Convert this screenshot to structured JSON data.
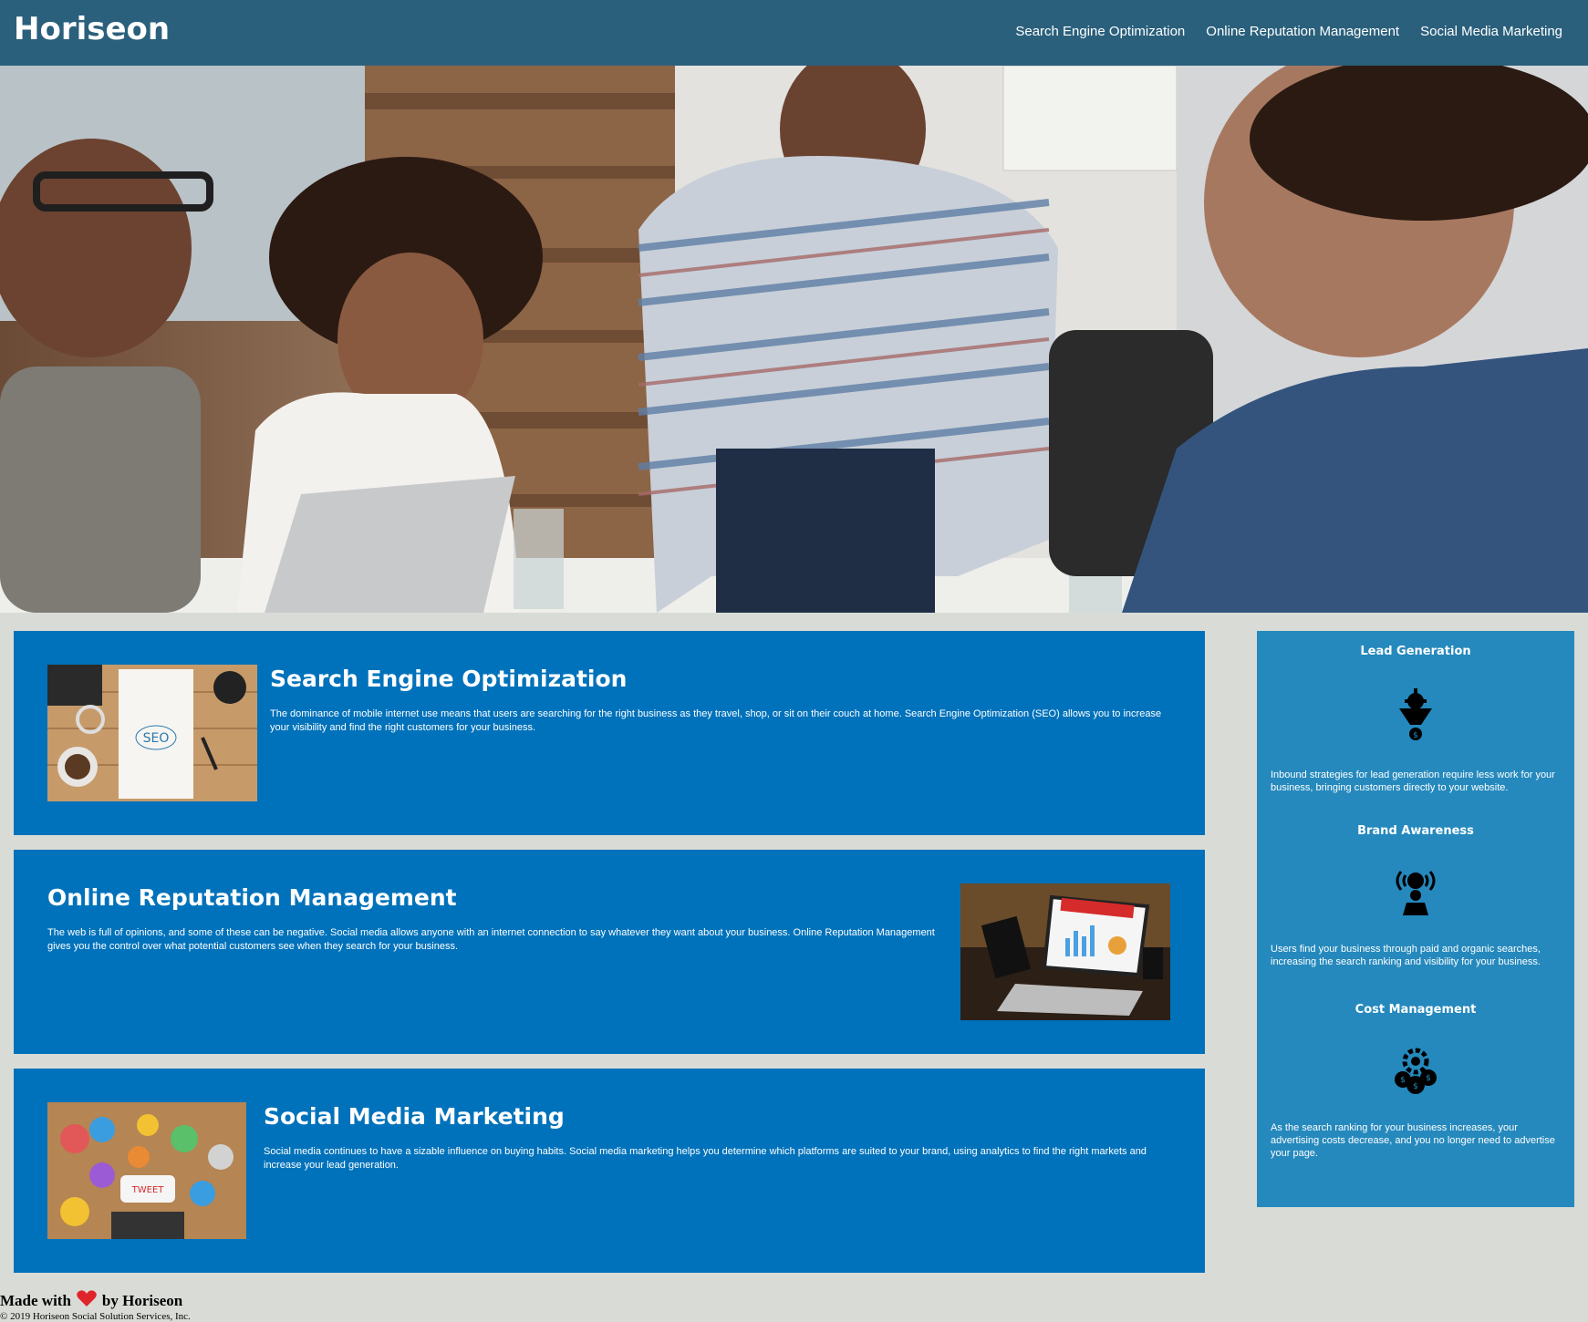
{
  "header": {
    "logo": "Horiseon",
    "nav": [
      {
        "label": "Search Engine Optimization"
      },
      {
        "label": "Online Reputation Management"
      },
      {
        "label": "Social Media Marketing"
      }
    ]
  },
  "hero": {
    "alt": "team meeting photo"
  },
  "services": [
    {
      "title": "Search Engine Optimization",
      "text": "The dominance of mobile internet use means that users are searching for the right business as they travel, shop, or sit on their couch at home. Search Engine Optimization (SEO) allows you to increase your visibility and find the right customers for your business."
    },
    {
      "title": "Online Reputation Management",
      "text": "The web is full of opinions, and some of these can be negative. Social media allows anyone with an internet connection to say whatever they want about your business. Online Reputation Management gives you the control over what potential customers see when they search for your business."
    },
    {
      "title": "Social Media Marketing",
      "text": "Social media continues to have a sizable influence on buying habits. Social media marketing helps you determine which platforms are suited to your brand, using analytics to find the right markets and increase your lead generation."
    }
  ],
  "benefits": [
    {
      "title": "Lead Generation",
      "icon": "lead-generation-icon",
      "text": "Inbound strategies for lead generation require less work for your business, bringing customers directly to your website."
    },
    {
      "title": "Brand Awareness",
      "icon": "brand-awareness-icon",
      "text": "Users find your business through paid and organic searches, increasing the search ranking and visibility for your business."
    },
    {
      "title": "Cost Management",
      "icon": "cost-management-icon",
      "text": "As the search ranking for your business increases, your advertising costs decrease, and you no longer need to advertise your page."
    }
  ],
  "footer": {
    "made_prefix": "Made with",
    "made_suffix": "by Horiseon",
    "copyright": "© 2019 Horiseon Social Solution Services, Inc."
  },
  "colors": {
    "header": "#2a607c",
    "card": "#0072bb",
    "aside": "#2589bd",
    "page": "#d9dcd6"
  }
}
